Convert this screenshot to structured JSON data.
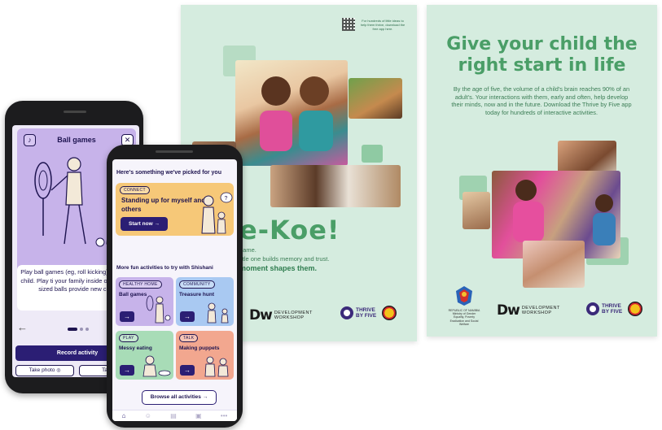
{
  "poster_middle": {
    "qr_caption": "For hundreds of little ideas to help them thrive, download the free app here.",
    "headline_fragment": "e-Koe!",
    "line1": "game.",
    "line2": "ittle one builds memory and trust.",
    "line3": "moment shapes them.",
    "dw_mark": "Dw",
    "dw_line1": "DEVELOPMENT",
    "dw_line2": "WORKSHOP",
    "tbf_line1": "THRIVE",
    "tbf_line2": "BY FIVE"
  },
  "poster_right": {
    "title_line1": "Give your child the",
    "title_line2": "right start in life",
    "body": "By the age of five, the volume of a child's brain reaches 90% of an adult's. Your interactions with them, early and often, help develop their minds, now and in the future. Download the Thrive by Five app today for hundreds of interactive activities.",
    "coat_caption": "REPUBLIC OF NAMIBIA Ministry of Gender Equality, Poverty Eradication and Social Welfare",
    "dw_mark": "Dw",
    "dw_line1": "DEVELOPMENT",
    "dw_line2": "WORKSHOP",
    "tbf_line1": "THRIVE",
    "tbf_line2": "BY FIVE"
  },
  "phone1": {
    "title": "Ball games",
    "close_glyph": "✕",
    "description": "Play ball games (eg, roll kicking)with your child. Play ti your family inside or outside. sized balls provide new chal",
    "back_glyph": "←",
    "record_label": "Record activity",
    "take_photo_label": "Take photo",
    "take_video_label": "Take vid"
  },
  "phone2": {
    "heading": "Here's something we've picked for you",
    "feature_chip": "CONNECT",
    "feature_title": "Standing up for myself and others",
    "start_label": "Start now",
    "subheading": "More fun activities to try with Shishani",
    "tiles": [
      {
        "chip": "HEALTHY HOME",
        "title": "Ball games",
        "color": "#c7b3ea"
      },
      {
        "chip": "COMMUNITY",
        "title": "Treasure hunt",
        "color": "#a9c9f2"
      },
      {
        "chip": "PLAY",
        "title": "Messy eating",
        "color": "#a8dcb7"
      },
      {
        "chip": "TALK",
        "title": "Making puppets",
        "color": "#f2a78f"
      }
    ],
    "browse_label": "Browse all activities",
    "arrow_glyph": "→"
  },
  "colors": {
    "poster_bg": "#d5ecdf",
    "poster_green": "#4a9e67",
    "brand_navy": "#2b1e74",
    "lavender": "#c7b3ea",
    "orange": "#f6c878"
  }
}
